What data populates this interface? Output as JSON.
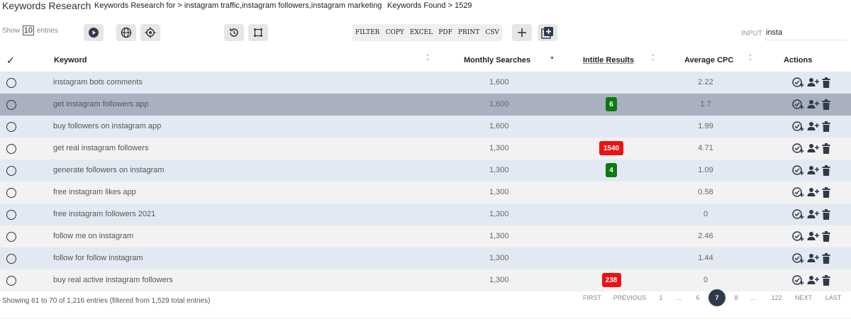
{
  "header": {
    "title": "Keywords Research",
    "research_for": "Keywords Research for > instagram traffic,instagram followers,instagram marketing",
    "found": "Keywords Found > 1529"
  },
  "toolbar": {
    "show_prefix": "Show",
    "show_value": "10",
    "show_suffix": "entries",
    "icons": [
      "play-icon",
      "globe-icon",
      "target-icon",
      "history-icon",
      "crop-icon",
      "add-icon",
      "add-box-icon"
    ],
    "export_buttons": [
      "FILTER",
      "COPY",
      "EXCEL",
      "PDF",
      "PRINT",
      "CSV"
    ],
    "input_label": "INPUT",
    "input_value": "insta"
  },
  "table": {
    "columns": {
      "check": "✓",
      "keyword": "Keyword",
      "monthly": "Monthly Searches",
      "intitle": "Intitle Results",
      "cpc": "Average CPC",
      "actions": "Actions"
    },
    "rows": [
      {
        "keyword": "instagram bots comments",
        "monthly": "1,600",
        "intitle": "",
        "intitle_color": "",
        "cpc": "2.22"
      },
      {
        "keyword": "get instagram followers app",
        "monthly": "1,600",
        "intitle": "6",
        "intitle_color": "green",
        "cpc": "1.7",
        "selected": true
      },
      {
        "keyword": "buy followers on instagram app",
        "monthly": "1,600",
        "intitle": "",
        "intitle_color": "",
        "cpc": "1.99"
      },
      {
        "keyword": "get real instagram followers",
        "monthly": "1,300",
        "intitle": "1540",
        "intitle_color": "red",
        "cpc": "4.71"
      },
      {
        "keyword": "generate followers on instagram",
        "monthly": "1,300",
        "intitle": "4",
        "intitle_color": "green",
        "cpc": "1.09"
      },
      {
        "keyword": "free instagram likes app",
        "monthly": "1,300",
        "intitle": "",
        "intitle_color": "",
        "cpc": "0.58"
      },
      {
        "keyword": "free instagram followers 2021",
        "monthly": "1,300",
        "intitle": "",
        "intitle_color": "",
        "cpc": "0"
      },
      {
        "keyword": "follow me on instagram",
        "monthly": "1,300",
        "intitle": "",
        "intitle_color": "",
        "cpc": "2.46"
      },
      {
        "keyword": "follow for follow instagram",
        "monthly": "1,300",
        "intitle": "",
        "intitle_color": "",
        "cpc": "1.44"
      },
      {
        "keyword": "buy real active instagram followers",
        "monthly": "1,300",
        "intitle": "238",
        "intitle_color": "red",
        "cpc": "0"
      }
    ]
  },
  "footer": {
    "info": "Showing 61 to 70 of 1,216 entries (filtered from 1,529 total entries)",
    "first": "FIRST",
    "previous": "PREVIOUS",
    "p1": "1",
    "ell1": "...",
    "p6": "6",
    "current": "7",
    "p8": "8",
    "ell2": "...",
    "p122": "122",
    "next": "NEXT",
    "last": "LAST"
  },
  "colors": {
    "row_even": "#e3e9f2",
    "row_odd": "#f2f2f2",
    "row_selected": "#a9b1c1",
    "badge_green": "#0a7a13",
    "badge_red": "#ee1111",
    "pager_current": "#2f3a4a"
  }
}
